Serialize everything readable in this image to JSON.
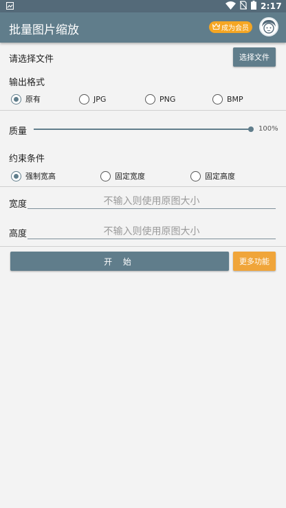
{
  "status_bar": {
    "time": "2:17",
    "icons": [
      "notification-icon",
      "wifi-icon",
      "no-sim-icon",
      "battery-icon"
    ]
  },
  "app_bar": {
    "title": "批量图片缩放",
    "vip_badge": "成为会员",
    "icons": [
      "crown-icon",
      "avatar"
    ]
  },
  "file_section": {
    "label": "请选择文件",
    "choose_button": "选择文件"
  },
  "format_section": {
    "label": "输出格式",
    "options": [
      {
        "label": "原有",
        "checked": true
      },
      {
        "label": "JPG",
        "checked": false
      },
      {
        "label": "PNG",
        "checked": false
      },
      {
        "label": "BMP",
        "checked": false
      }
    ]
  },
  "quality_section": {
    "label": "质量",
    "value": "100%",
    "level": 1.0
  },
  "constraint_section": {
    "label": "约束条件",
    "options": [
      {
        "label": "强制宽高",
        "checked": true
      },
      {
        "label": "固定宽度",
        "checked": false
      },
      {
        "label": "固定高度",
        "checked": false
      }
    ]
  },
  "dimensions": {
    "width_label": "宽度",
    "width_placeholder": "不输入则使用原图大小",
    "height_label": "高度",
    "height_placeholder": "不输入则使用原图大小"
  },
  "actions": {
    "start_button": "开 始",
    "more_button": "更多功能"
  },
  "colors": {
    "primary": "#607d8b",
    "status_bar": "#546a79",
    "accent_orange": "#f5a623",
    "background": "#f3f3f3"
  }
}
